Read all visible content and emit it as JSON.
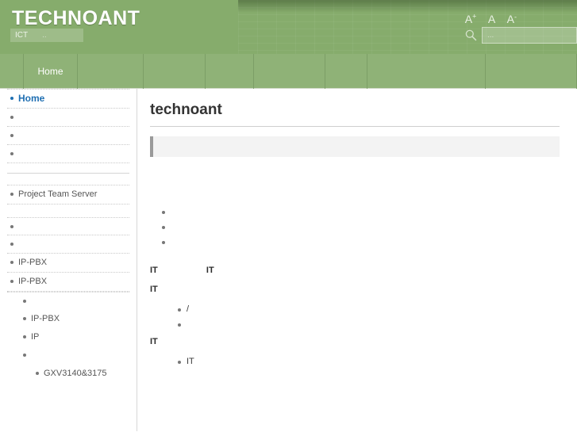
{
  "header": {
    "title": "TECHNOANT",
    "subtitle_primary": "ICT",
    "subtitle_secondary": "..",
    "font_size_increase": "A",
    "font_size_normal": "A",
    "font_size_decrease": "A",
    "font_size_increase_sup": "+",
    "font_size_decrease_sup": "-",
    "search_placeholder": "...",
    "search_value": "",
    "search_icon": "search-icon",
    "brand_color": "#86ac6c",
    "nav_color": "#8fb277"
  },
  "nav": {
    "items": [
      {
        "label": "",
        "width": 30
      },
      {
        "label": "Home",
        "width": 68
      },
      {
        "label": "",
        "width": 83
      },
      {
        "label": "",
        "width": 78
      },
      {
        "label": "",
        "width": 61
      },
      {
        "label": "",
        "width": 90
      },
      {
        "label": "",
        "width": 53
      },
      {
        "label": "",
        "width": 149
      },
      {
        "label": "",
        "width": 115
      }
    ]
  },
  "sidebar": {
    "items": [
      {
        "label": "Home",
        "level": 1,
        "active": true
      },
      {
        "label": "",
        "level": 1,
        "active": false
      },
      {
        "label": "",
        "level": 1,
        "active": false
      },
      {
        "label": "",
        "level": 1,
        "active": false
      }
    ],
    "items2": [
      {
        "label": "Project Team Server",
        "level": 1,
        "active": false
      }
    ],
    "items3": [
      {
        "label": "",
        "level": 1,
        "active": false
      },
      {
        "label": "",
        "level": 1,
        "active": false
      },
      {
        "label": "IP-PBX",
        "level": 1,
        "active": false
      },
      {
        "label": "IP-PBX",
        "level": 1,
        "active": false
      }
    ],
    "items4": [
      {
        "label": "",
        "level": 2,
        "active": false
      },
      {
        "label": "IP-PBX",
        "level": 2,
        "active": false
      },
      {
        "label": "IP",
        "level": 2,
        "active": false
      },
      {
        "label": "",
        "level": 2,
        "active": false
      },
      {
        "label": "GXV3140&3175",
        "level": 3,
        "active": false
      }
    ]
  },
  "content": {
    "title": "technoant",
    "callout_text": "",
    "bullets_1": [
      "",
      "",
      ""
    ],
    "para_it_1": "IT                    IT",
    "para_it_2": "IT",
    "bullets_2": [
      "/",
      ""
    ],
    "para_it_3": "IT",
    "bullets_3": [
      "IT"
    ]
  }
}
